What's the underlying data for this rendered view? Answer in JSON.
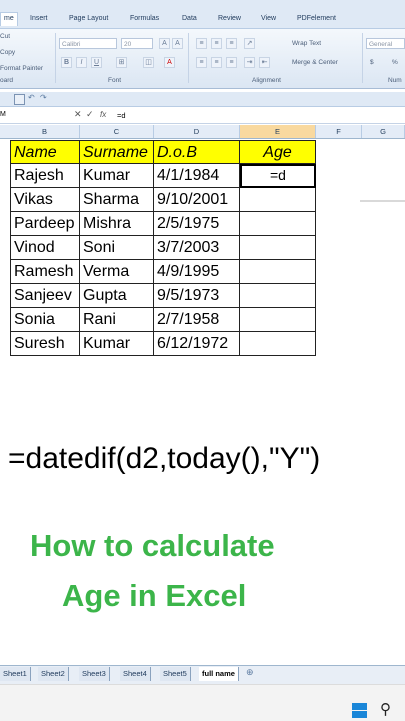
{
  "ribbon": {
    "tabs": [
      "me",
      "Insert",
      "Page Layout",
      "Formulas",
      "Data",
      "Review",
      "View",
      "PDFelement"
    ],
    "clipboard": {
      "cut": "Cut",
      "copy": "Copy",
      "format_painter": "Format Painter",
      "group": "oard"
    },
    "font": {
      "name": "Calibri",
      "size": "20",
      "group": "Font",
      "bold": "B",
      "italic": "I",
      "underline": "U"
    },
    "alignment": {
      "wrap": "Wrap Text",
      "merge": "Merge & Center",
      "group": "Alignment"
    },
    "number": {
      "format": "General",
      "currency": "$",
      "percent": "%",
      "group": "Num"
    }
  },
  "formula_bar": {
    "name_box": "M",
    "fx": "fx",
    "content": "=d"
  },
  "columns": [
    "B",
    "C",
    "D",
    "E",
    "F",
    "G"
  ],
  "table": {
    "headers": [
      "Name",
      "Surname",
      "D.o.B",
      "Age"
    ],
    "rows": [
      [
        "Rajesh",
        "Kumar",
        "4/1/1984",
        "=d"
      ],
      [
        "Vikas",
        "Sharma",
        "9/10/2001",
        ""
      ],
      [
        "Pardeep",
        "Mishra",
        "2/5/1975",
        ""
      ],
      [
        "Vinod",
        "Soni",
        "3/7/2003",
        ""
      ],
      [
        "Ramesh",
        "Verma",
        "4/9/1995",
        ""
      ],
      [
        "Sanjeev",
        "Gupta",
        "9/5/1973",
        ""
      ],
      [
        "Sonia",
        "Rani",
        "2/7/1958",
        ""
      ],
      [
        "Suresh",
        "Kumar",
        "6/12/1972",
        ""
      ]
    ]
  },
  "overlay": {
    "formula": "=datedif(d2,today(),\"Y\")",
    "title_line1": "How to calculate",
    "title_line2": "Age in Excel"
  },
  "sheets": [
    "Sheet1",
    "Sheet2",
    "Sheet3",
    "Sheet4",
    "Sheet5",
    "full name"
  ],
  "colors": {
    "header_fill": "#ffff00",
    "title_green": "#3cb54a",
    "ribbon_bg": "#dfe9f5"
  }
}
